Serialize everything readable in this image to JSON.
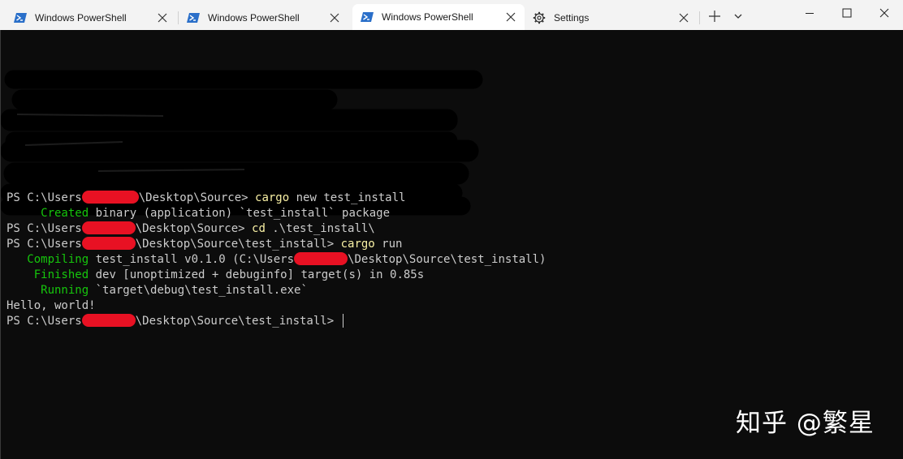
{
  "tabs": [
    {
      "label": "Windows PowerShell",
      "icon": "powershell-icon",
      "active": false
    },
    {
      "label": "Windows PowerShell",
      "icon": "powershell-icon",
      "active": false
    },
    {
      "label": "Windows PowerShell",
      "icon": "powershell-icon",
      "active": true
    },
    {
      "label": "Settings",
      "icon": "gear-icon",
      "active": false
    }
  ],
  "terminal": {
    "lines": [
      {
        "pre": "PS C:\\Users",
        "post": "\\Desktop\\Source> ",
        "cmd": "cargo",
        "rest": " new test_install"
      },
      {
        "status": "     Created",
        "rest": " binary (application) `test_install` package"
      },
      {
        "pre": "PS C:\\Users",
        "post": "\\Desktop\\Source> ",
        "cmd": "cd",
        "rest": " .\\test_install\\"
      },
      {
        "pre": "PS C:\\Users",
        "post": "\\Desktop\\Source\\test_install> ",
        "cmd": "cargo",
        "rest": " run"
      },
      {
        "status": "   Compiling",
        "rest": " test_install v0.1.0 (C:\\Users",
        "post": "\\Desktop\\Source\\test_install)"
      },
      {
        "status": "    Finished",
        "rest": " dev [unoptimized + debuginfo] target(s) in 0.85s"
      },
      {
        "status": "     Running",
        "rest": " `target\\debug\\test_install.exe`"
      },
      {
        "text": "Hello, world!"
      },
      {
        "pre": "PS C:\\Users",
        "post": "\\Desktop\\Source\\test_install> "
      }
    ]
  },
  "watermark": "知乎 @繁星",
  "colors": {
    "background": "#0c0c0c",
    "foreground": "#cccccc",
    "command": "#f9f1a5",
    "status": "#16c60c",
    "redaction": "#e81123"
  }
}
